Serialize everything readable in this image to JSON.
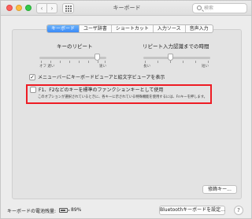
{
  "window": {
    "title": "キーボード",
    "search_placeholder": "検索",
    "nav_back": "‹",
    "nav_forward": "›"
  },
  "tabs": [
    {
      "label": "キーボード",
      "active": true
    },
    {
      "label": "ユーザ辞書",
      "active": false
    },
    {
      "label": "ショートカット",
      "active": false
    },
    {
      "label": "入力ソース",
      "active": false
    },
    {
      "label": "音声入力",
      "active": false
    }
  ],
  "key_repeat": {
    "label": "キーのリピート",
    "left_end": "オフ 遅い",
    "right_end": "速い"
  },
  "repeat_delay": {
    "label": "リピート入力認識までの時間",
    "left_end": "長い",
    "right_end": "短い"
  },
  "options": {
    "show_viewer_label": "メニューバーにキーボードビューアと絵文字ビューアを表示",
    "show_viewer_checked": true,
    "fn_keys_label": "F1、F2などのキーを標準のファンクションキーとして使用",
    "fn_keys_checked": false,
    "fn_keys_note": "このオプションが選択されているときに、各キーに示されている特殊機能を使用するには、Fnキーを押します。"
  },
  "modifier_keys_button": "修飾キー...",
  "bottom": {
    "battery_label": "キーボードの電池残量:",
    "battery_percent": "89%",
    "battery_level": 0.89,
    "bluetooth_button": "Bluetoothキーボードを設定...",
    "help_button": "?"
  },
  "colors": {
    "accent": "#3a8af7",
    "highlight_box": "#ee1c24"
  }
}
